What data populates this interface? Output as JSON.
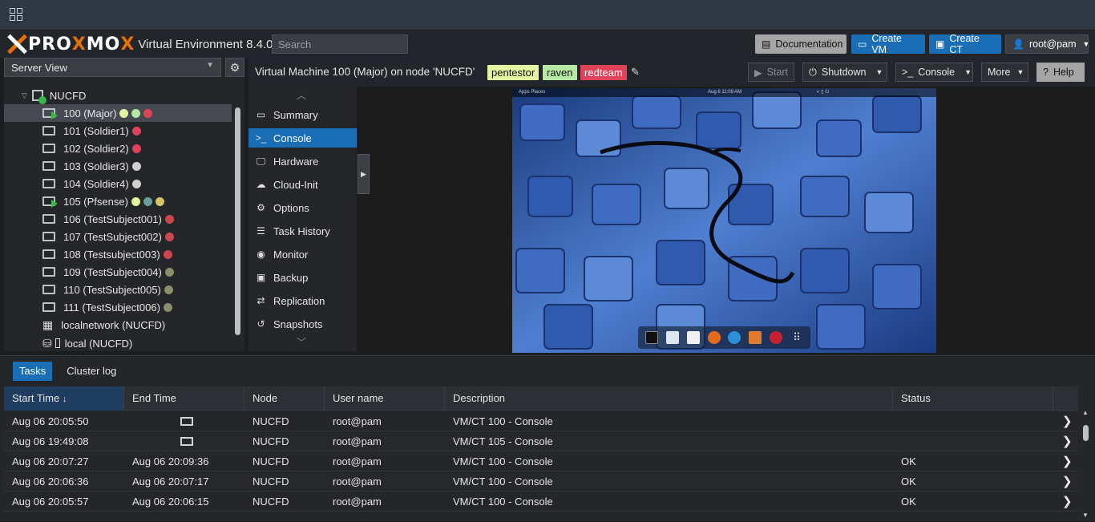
{
  "header": {
    "brand_prefix": "PRO",
    "brand_x": "X",
    "brand_suffix": "MO",
    "brand_end": "X",
    "version": "Virtual Environment 8.4.0",
    "search_placeholder": "Search",
    "buttons": {
      "documentation": "Documentation",
      "create_vm": "Create VM",
      "create_ct": "Create CT",
      "user": "root@pam"
    }
  },
  "left": {
    "view": "Server View",
    "node": "NUCFD",
    "items": [
      {
        "label": "100 (Major)",
        "running": true,
        "tags": [
          "#e4f4a0",
          "#b6e8a4",
          "#e0425a"
        ]
      },
      {
        "label": "101 (Soldier1)",
        "running": false,
        "tags": [
          "#e0425a"
        ]
      },
      {
        "label": "102 (Soldier2)",
        "running": false,
        "tags": [
          "#e0425a"
        ]
      },
      {
        "label": "103 (Soldier3)",
        "running": false,
        "tags": [
          "#cfcfcf"
        ]
      },
      {
        "label": "104 (Soldier4)",
        "running": false,
        "tags": [
          "#cfcfcf"
        ]
      },
      {
        "label": "105 (Pfsense)",
        "running": true,
        "tags": [
          "#e4f4a0",
          "#6a9f9e",
          "#d6c46a"
        ]
      },
      {
        "label": "106 (TestSubject001)",
        "running": false,
        "tags": [
          "#c9484e"
        ]
      },
      {
        "label": "107 (TestSubject002)",
        "running": false,
        "tags": [
          "#c9484e"
        ]
      },
      {
        "label": "108 (Testsubject003)",
        "running": false,
        "tags": [
          "#c9484e"
        ]
      },
      {
        "label": "109 (TestSubject004)",
        "running": false,
        "tags": [
          "#8a8f6a"
        ]
      },
      {
        "label": "110 (TestSubject005)",
        "running": false,
        "tags": [
          "#8a8f6a"
        ]
      },
      {
        "label": "111 (TestSubject006)",
        "running": false,
        "tags": [
          "#8a8f6a"
        ]
      }
    ],
    "network": "localnetwork (NUCFD)",
    "storage": "local (NUCFD)"
  },
  "vm": {
    "title": "Virtual Machine 100 (Major) on node 'NUCFD'",
    "tags": [
      "pentestor",
      "raven",
      "redteam"
    ],
    "buttons": {
      "start": "Start",
      "shutdown": "Shutdown",
      "console": "Console",
      "more": "More",
      "help": "Help"
    },
    "nav": [
      {
        "label": "Summary",
        "icon": "summary-icon",
        "glyph": "▭"
      },
      {
        "label": "Console",
        "icon": "console-icon",
        "glyph": ">_"
      },
      {
        "label": "Hardware",
        "icon": "monitor-icon",
        "glyph": "🖵"
      },
      {
        "label": "Cloud-Init",
        "icon": "cloud-icon",
        "glyph": "☁"
      },
      {
        "label": "Options",
        "icon": "gear-icon",
        "glyph": "⚙"
      },
      {
        "label": "Task History",
        "icon": "list-icon",
        "glyph": "☰"
      },
      {
        "label": "Monitor",
        "icon": "eye-icon",
        "glyph": "◉"
      },
      {
        "label": "Backup",
        "icon": "floppy-icon",
        "glyph": "▣"
      },
      {
        "label": "Replication",
        "icon": "retweet-icon",
        "glyph": "⇄"
      },
      {
        "label": "Snapshots",
        "icon": "history-icon",
        "glyph": "↺"
      }
    ],
    "active_nav": "Console"
  },
  "console_screen": {
    "topbar_left": "Apps   Places",
    "topbar_time": "Aug 6  11:09 AM"
  },
  "bottom": {
    "tabs": [
      "Tasks",
      "Cluster log"
    ],
    "columns": [
      "Start Time",
      "End Time",
      "Node",
      "User name",
      "Description",
      "Status"
    ],
    "rows": [
      {
        "start": "Aug 06 20:05:50",
        "end": "",
        "running": true,
        "node": "NUCFD",
        "user": "root@pam",
        "desc": "VM/CT 100 - Console",
        "status": ""
      },
      {
        "start": "Aug 06 19:49:08",
        "end": "",
        "running": true,
        "node": "NUCFD",
        "user": "root@pam",
        "desc": "VM/CT 105 - Console",
        "status": ""
      },
      {
        "start": "Aug 06 20:07:27",
        "end": "Aug 06 20:09:36",
        "running": false,
        "node": "NUCFD",
        "user": "root@pam",
        "desc": "VM/CT 100 - Console",
        "status": "OK"
      },
      {
        "start": "Aug 06 20:06:36",
        "end": "Aug 06 20:07:17",
        "running": false,
        "node": "NUCFD",
        "user": "root@pam",
        "desc": "VM/CT 100 - Console",
        "status": "OK"
      },
      {
        "start": "Aug 06 20:05:57",
        "end": "Aug 06 20:06:15",
        "running": false,
        "node": "NUCFD",
        "user": "root@pam",
        "desc": "VM/CT 100 - Console",
        "status": "OK"
      }
    ]
  },
  "colors": {
    "accent": "#1a6eb5",
    "brand": "#e57000",
    "running": "#3bb64c"
  }
}
